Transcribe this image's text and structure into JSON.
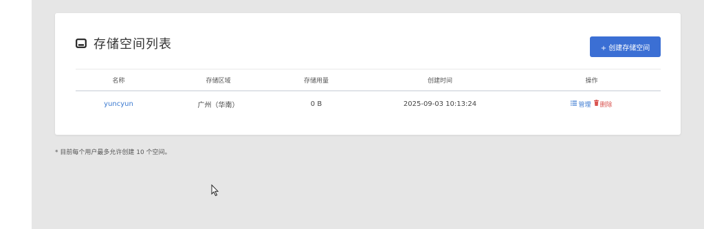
{
  "page": {
    "title": "存储空间列表"
  },
  "toolbar": {
    "create_label": "+ 创建存储空间"
  },
  "table": {
    "headers": {
      "name": "名称",
      "region": "存储区域",
      "usage": "存储用量",
      "created": "创建时间",
      "actions": "操作"
    },
    "rows": [
      {
        "name": "yuncyun",
        "region": "广州（华南）",
        "usage": "0 B",
        "created": "2025-09-03 10:13:24",
        "manage": "管理",
        "delete": "删除"
      }
    ]
  },
  "footnote": "* 目前每个用户最多允许创建 10 个空间。",
  "colors": {
    "accent": "#3b6fd4",
    "link": "#3b7ad0",
    "danger": "#d9534f",
    "background": "#e6e6e6"
  },
  "icons": {
    "title": "storage-box-icon",
    "manage": "list-icon",
    "delete": "trash-icon",
    "cursor": "mouse-pointer-icon"
  }
}
